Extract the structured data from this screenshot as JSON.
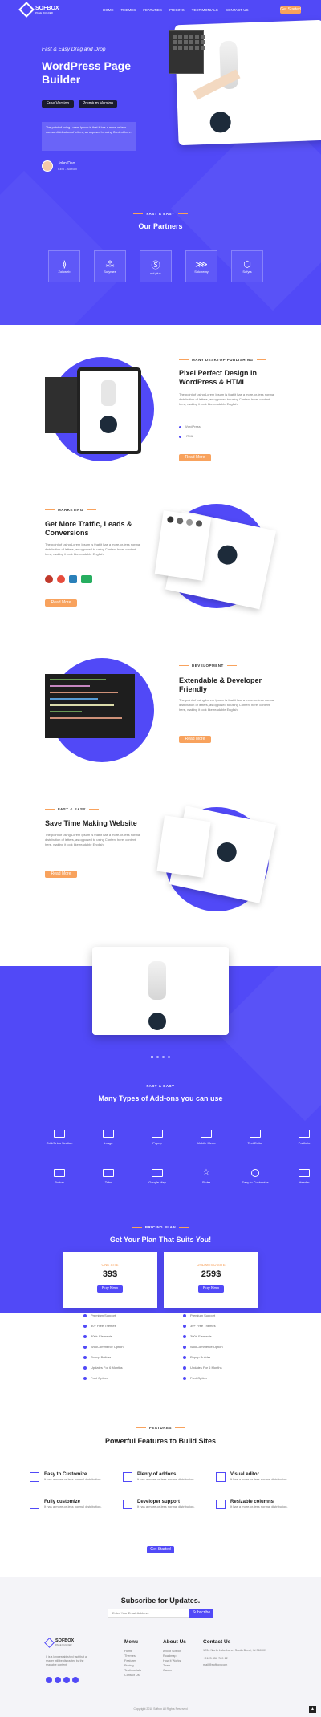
{
  "header": {
    "logo": "SOFBOX",
    "logo_sub": "PAGE BUILDER",
    "nav": [
      "HOME",
      "THEMES",
      "FEATURES",
      "PRICING",
      "TESTIMONIALS",
      "CONTACT US"
    ],
    "cta": "Get Started"
  },
  "hero": {
    "subtitle": "Fast & Easy Drag and Drop",
    "title_1": "WordPress Page",
    "title_2": "Builder",
    "btn_free": "Free Version",
    "btn_premium": "Premium Version",
    "quote": "The point of using Lorem Ipsum is that it has a more-or-less normal distribution of letters, as opposed to using Content here.",
    "author": "John Deo",
    "author_role": "CEO - SofBox"
  },
  "partners": {
    "tag": "FAST & EASY",
    "title": "Our Partners",
    "items": [
      "Zolkweb",
      "Sofymes",
      "sol plus",
      "Solchemy",
      "Sofyrs"
    ]
  },
  "features": [
    {
      "tag": "MANY DESKTOP PUBLISHING",
      "title_1": "Pixel Perfect Design in",
      "title_2": "WordPress & HTML",
      "text": "The point of using Lorem Ipsum is that it has a more-or-less normal distribution of letters, as opposed to using Content here, content here, making it look like readable English.",
      "list": [
        "WordPress",
        "HTML"
      ],
      "btn": "Read More"
    },
    {
      "tag": "MARKETING",
      "title_1": "Get More Traffic, Leads &",
      "title_2": "Conversions",
      "text": "The point of using Lorem Ipsum is that it has a more-or-less normal distribution of letters, as opposed to using Content here, content here, making it look like readable English.",
      "btn": "Read More"
    },
    {
      "tag": "DEVELOPMENT",
      "title_1": "Extendable & Developer",
      "title_2": "Friendly",
      "text": "The point of using Lorem Ipsum is that it has a more-or-less normal distribution of letters, as opposed to using Content here, content here, making it look like readable English.",
      "btn": "Read More"
    },
    {
      "tag": "FAST & EASY",
      "title_1": "Save Time Making Website",
      "title_2": "",
      "text": "The point of using Lorem Ipsum is that it has a more-or-less normal distribution of letters, as opposed to using Content here, content here, making it look like readable English.",
      "btn": "Read More"
    }
  ],
  "addons": {
    "tag": "FAST & EASY",
    "title": "Many Types of Add-ons you can use",
    "items": [
      "Grid/Grids Section",
      "Image",
      "Popup",
      "Mobile Menu",
      "Text Editor",
      "Portfolio",
      "Button",
      "Tabs",
      "Google Map",
      "Slider",
      "Easy to Customize",
      "Header"
    ]
  },
  "pricing": {
    "tag": "PRICING PLAN",
    "title": "Get Your Plan That Suits You!",
    "plans": [
      {
        "name": "ONE SITE",
        "price": "39$",
        "btn": "Buy Now"
      },
      {
        "name": "UNLIMITED SITE",
        "price": "259$",
        "btn": "Buy Now"
      }
    ],
    "list": [
      "Premium Support",
      "30+ Free Themes",
      "300+ Elements",
      "WooCommerce Option",
      "Popup Builder",
      "Updates For 6 Months",
      "Font Option"
    ]
  },
  "powerful": {
    "tag": "FEATURES",
    "title": "Powerful Features to Build Sites",
    "items": [
      {
        "title": "Easy to Customize",
        "text": "It has a more-or-less normal distribution."
      },
      {
        "title": "Plenty of addons",
        "text": "It has a more-or-less normal distribution."
      },
      {
        "title": "Visual editor",
        "text": "It has a more-or-less normal distribution."
      },
      {
        "title": "Fully customize",
        "text": "It has a more-or-less normal distribution."
      },
      {
        "title": "Developer support",
        "text": "It has a more-or-less normal distribution."
      },
      {
        "title": "Resizable columns",
        "text": "It has a more-or-less normal distribution."
      }
    ],
    "btn": "Get Started"
  },
  "subscribe": {
    "title": "Subscribe for Updates.",
    "placeholder": "Enter Your Email Address",
    "btn": "Subscribe"
  },
  "footer": {
    "about": "It is a long established fact that a reader will be distracted by the readable content.",
    "menu_title": "Menu",
    "menu": [
      "Home",
      "Themes",
      "Features",
      "Pricing",
      "Testimonials",
      "Contact Us"
    ],
    "about_title": "About Us",
    "about_links": [
      "About Sofbox",
      "Roadmap",
      "How it Works",
      "Team",
      "Career"
    ],
    "contact_title": "Contact Us",
    "contact": [
      "1234 North Luke Lane, South Bend, IN 360001",
      "+0123 456 789 12",
      "mail@sofbox.com"
    ],
    "copyright": "Copyright 2018 Sofbox All Rights Reserved"
  },
  "colors": {
    "primary": "#5149f7",
    "accent": "#f8a25d"
  }
}
